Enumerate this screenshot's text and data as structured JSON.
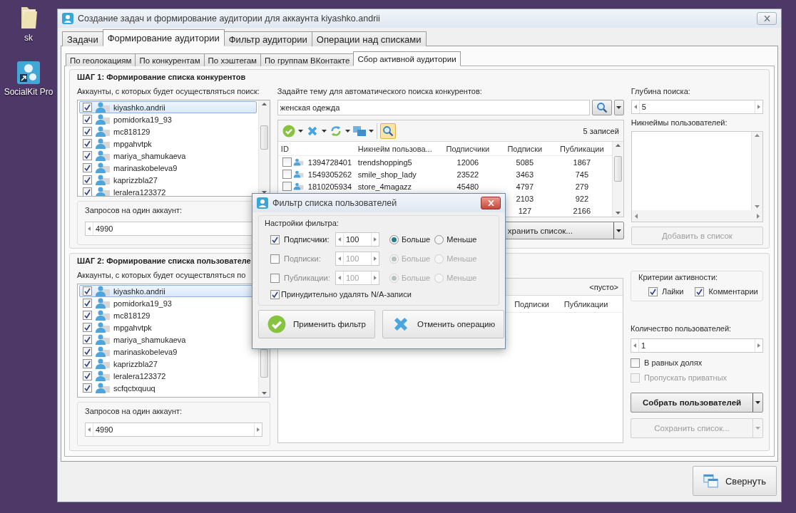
{
  "desktop_icons": [
    {
      "label": "sk",
      "kind": "folder"
    },
    {
      "label": "SocialKit Pro",
      "kind": "app"
    }
  ],
  "window": {
    "title": "Создание задач и формирование аудитории для аккаунта kiyashko.andrii"
  },
  "tabs": [
    {
      "label": "Задачи",
      "selected": false
    },
    {
      "label": "Формирование аудитории",
      "selected": true
    },
    {
      "label": "Фильтр аудитории",
      "selected": false
    },
    {
      "label": "Операции над списками",
      "selected": false
    }
  ],
  "subtabs": [
    {
      "label": "По геолокациям",
      "selected": false
    },
    {
      "label": "По конкурентам",
      "selected": false
    },
    {
      "label": "По хэштегам",
      "selected": false
    },
    {
      "label": "По группам ВКонтакте",
      "selected": false
    },
    {
      "label": "Сбор активной аудитории",
      "selected": true
    }
  ],
  "step1": {
    "title": "ШАГ 1: Формирование списка конкурентов",
    "accounts_label": "Аккаунты, с которых будет осуществляться поиск:",
    "accounts": [
      {
        "name": "kiyashko.andrii",
        "checked": true,
        "selected": true
      },
      {
        "name": "pomidorka19_93",
        "checked": true,
        "selected": false
      },
      {
        "name": "mc818129",
        "checked": true,
        "selected": false
      },
      {
        "name": "mpgahvtpk",
        "checked": true,
        "selected": false
      },
      {
        "name": "mariya_shamukaeva",
        "checked": true,
        "selected": false
      },
      {
        "name": "marinaskobeleva9",
        "checked": true,
        "selected": false
      },
      {
        "name": "kaprizzbla27",
        "checked": true,
        "selected": false
      },
      {
        "name": "leralera123372",
        "checked": true,
        "selected": false
      }
    ],
    "requests_label": "Запросов на один аккаунт:",
    "requests": "4990",
    "topic_label": "Задайте тему для автоматического поиска конкурентов:",
    "topic": "женская одежда",
    "record_count": "5 записей",
    "columns": [
      "ID",
      "Никнейм пользова...",
      "Подписчики",
      "Подписки",
      "Публикации"
    ],
    "rows": [
      {
        "id": "1394728401",
        "nickname": "trendshopping5",
        "followers": "12006",
        "following": "5085",
        "posts": "1867",
        "checked": false
      },
      {
        "id": "1549305262",
        "nickname": "smile_shop_lady",
        "followers": "23522",
        "following": "3463",
        "posts": "745",
        "checked": false
      },
      {
        "id": "1810205934",
        "nickname": "store_4magazz",
        "followers": "45480",
        "following": "4797",
        "posts": "279",
        "checked": false
      },
      {
        "following": "2103",
        "posts": "922"
      },
      {
        "following": "127",
        "posts": "2166"
      }
    ],
    "save_button": "хранить список...",
    "depth_label": "Глубина поиска:",
    "depth": "5",
    "nicknames_label": "Никнеймы пользователей:",
    "add_button": {
      "label": "Добавить в список",
      "disabled": true
    }
  },
  "step2": {
    "title": "ШАГ 2: Формирование списка пользователе",
    "accounts_label": "Аккаунты, с которых будет осуществляться по",
    "accounts": [
      {
        "name": "kiyashko.andrii",
        "checked": true,
        "selected": true
      },
      {
        "name": "pomidorka19_93",
        "checked": true,
        "selected": false
      },
      {
        "name": "mc818129",
        "checked": true,
        "selected": false
      },
      {
        "name": "mpgahvtpk",
        "checked": true,
        "selected": false
      },
      {
        "name": "mariya_shamukaeva",
        "checked": true,
        "selected": false
      },
      {
        "name": "marinaskobeleva9",
        "checked": true,
        "selected": false
      },
      {
        "name": "kaprizzbla27",
        "checked": true,
        "selected": false
      },
      {
        "name": "leralera123372",
        "checked": true,
        "selected": false
      },
      {
        "name": "scfqctxquuq",
        "checked": true,
        "selected": false
      }
    ],
    "requests_label": "Запросов на один аккаунт:",
    "requests": "4990",
    "empty_label": "<пусто>",
    "columns": [
      "Подписки",
      "Публикации"
    ],
    "criteria_label": "Критерии активности:",
    "criteria": [
      {
        "label": "Лайки",
        "checked": true
      },
      {
        "label": "Комментарии",
        "checked": true
      }
    ],
    "count_label": "Количество пользователей:",
    "count": "1",
    "options": [
      {
        "label": "В равных долях",
        "checked": false,
        "disabled": false
      },
      {
        "label": "Пропускать приватных",
        "checked": false,
        "disabled": true
      }
    ],
    "collect_button": "Собрать пользователей",
    "save_button": {
      "label": "Сохранить список...",
      "disabled": true
    }
  },
  "minimize_button": "Свернуть",
  "dialog": {
    "title": "Фильтр списка пользователей",
    "group_label": "Настройки фильтра:",
    "filters": [
      {
        "label": "Подписчики:",
        "checked": true,
        "value": "100",
        "options": [
          {
            "label": "Больше",
            "selected": true
          },
          {
            "label": "Меньше",
            "selected": false
          }
        ]
      },
      {
        "label": "Подписки:",
        "checked": false,
        "value": "100",
        "options": [
          {
            "label": "Больше",
            "selected": true
          },
          {
            "label": "Меньше",
            "selected": false
          }
        ]
      },
      {
        "label": "Публикации:",
        "checked": false,
        "value": "100",
        "options": [
          {
            "label": "Больше",
            "selected": true
          },
          {
            "label": "Меньше",
            "selected": false
          }
        ]
      }
    ],
    "force_na": {
      "label": "Принудительно удалять N/A-записи",
      "checked": true
    },
    "buttons": [
      {
        "label": "Применить фильтр",
        "kind": "apply"
      },
      {
        "label": "Отменить операцию",
        "kind": "cancel"
      }
    ]
  }
}
